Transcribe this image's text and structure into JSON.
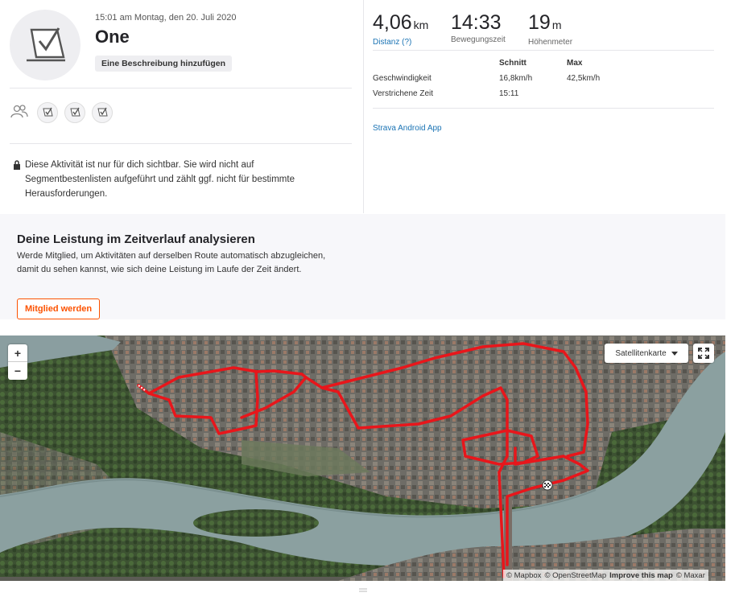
{
  "activity": {
    "datetime": "15:01 am Montag, den 20. Juli 2020",
    "title": "One",
    "add_description_label": "Eine Beschreibung hinzufügen",
    "privacy_text": "Diese Aktivität ist nur für dich sichtbar. Sie wird nicht auf Segmentbestenlisten aufgeführt und zählt ggf. nicht für bestimmte Herausforderungen."
  },
  "stats": {
    "distance": {
      "value": "4,06",
      "unit": "km",
      "label": "Distanz (?)"
    },
    "moving_time": {
      "value": "14:33",
      "label": "Bewegungszeit"
    },
    "elevation": {
      "value": "19",
      "unit": "m",
      "label": "Höhenmeter"
    }
  },
  "table": {
    "headers": [
      "Schnitt",
      "Max"
    ],
    "rows": [
      {
        "label": "Geschwindigkeit",
        "avg": "16,8km/h",
        "max": "42,5km/h"
      },
      {
        "label": "Verstrichene Zeit",
        "avg": "15:11",
        "max": ""
      }
    ]
  },
  "device": "Strava Android App",
  "promo": {
    "heading": "Deine Leistung im Zeitverlauf analysieren",
    "text": "Werde Mitglied, um Aktivitäten auf derselben Route automatisch abzugleichen, damit du sehen kannst, wie sich deine Leistung im Laufe der Zeit ändert.",
    "button": "Mitglied werden"
  },
  "map": {
    "zoom_in": "+",
    "zoom_out": "−",
    "layer_select": "Satellitenkarte",
    "attribution": {
      "mapbox": "© Mapbox",
      "osm": "© OpenStreetMap",
      "improve": "Improve this map",
      "maxar": "© Maxar"
    }
  },
  "colors": {
    "accent": "#fc5200",
    "link": "#1a73b4",
    "route": "#e8161b",
    "trend": "#2bbbd8",
    "highlight": "#f5a623"
  }
}
